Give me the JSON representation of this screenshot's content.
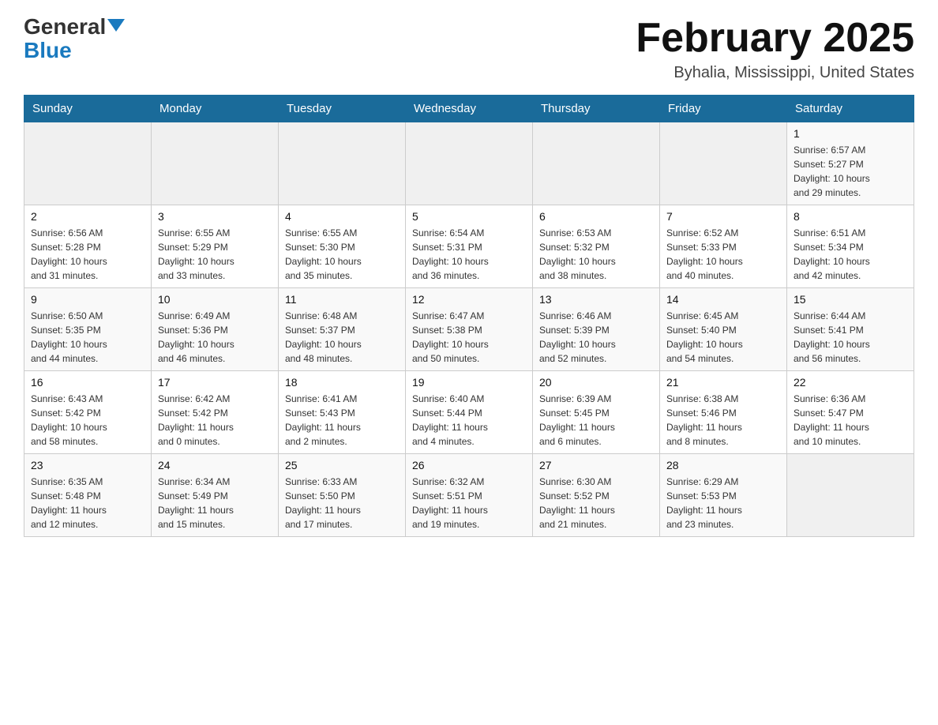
{
  "header": {
    "logo_general": "General",
    "logo_blue": "Blue",
    "month_title": "February 2025",
    "location": "Byhalia, Mississippi, United States"
  },
  "days_of_week": [
    "Sunday",
    "Monday",
    "Tuesday",
    "Wednesday",
    "Thursday",
    "Friday",
    "Saturday"
  ],
  "weeks": [
    {
      "days": [
        {
          "number": "",
          "info": "",
          "empty": true
        },
        {
          "number": "",
          "info": "",
          "empty": true
        },
        {
          "number": "",
          "info": "",
          "empty": true
        },
        {
          "number": "",
          "info": "",
          "empty": true
        },
        {
          "number": "",
          "info": "",
          "empty": true
        },
        {
          "number": "",
          "info": "",
          "empty": true
        },
        {
          "number": "1",
          "info": "Sunrise: 6:57 AM\nSunset: 5:27 PM\nDaylight: 10 hours\nand 29 minutes.",
          "empty": false
        }
      ]
    },
    {
      "days": [
        {
          "number": "2",
          "info": "Sunrise: 6:56 AM\nSunset: 5:28 PM\nDaylight: 10 hours\nand 31 minutes.",
          "empty": false
        },
        {
          "number": "3",
          "info": "Sunrise: 6:55 AM\nSunset: 5:29 PM\nDaylight: 10 hours\nand 33 minutes.",
          "empty": false
        },
        {
          "number": "4",
          "info": "Sunrise: 6:55 AM\nSunset: 5:30 PM\nDaylight: 10 hours\nand 35 minutes.",
          "empty": false
        },
        {
          "number": "5",
          "info": "Sunrise: 6:54 AM\nSunset: 5:31 PM\nDaylight: 10 hours\nand 36 minutes.",
          "empty": false
        },
        {
          "number": "6",
          "info": "Sunrise: 6:53 AM\nSunset: 5:32 PM\nDaylight: 10 hours\nand 38 minutes.",
          "empty": false
        },
        {
          "number": "7",
          "info": "Sunrise: 6:52 AM\nSunset: 5:33 PM\nDaylight: 10 hours\nand 40 minutes.",
          "empty": false
        },
        {
          "number": "8",
          "info": "Sunrise: 6:51 AM\nSunset: 5:34 PM\nDaylight: 10 hours\nand 42 minutes.",
          "empty": false
        }
      ]
    },
    {
      "days": [
        {
          "number": "9",
          "info": "Sunrise: 6:50 AM\nSunset: 5:35 PM\nDaylight: 10 hours\nand 44 minutes.",
          "empty": false
        },
        {
          "number": "10",
          "info": "Sunrise: 6:49 AM\nSunset: 5:36 PM\nDaylight: 10 hours\nand 46 minutes.",
          "empty": false
        },
        {
          "number": "11",
          "info": "Sunrise: 6:48 AM\nSunset: 5:37 PM\nDaylight: 10 hours\nand 48 minutes.",
          "empty": false
        },
        {
          "number": "12",
          "info": "Sunrise: 6:47 AM\nSunset: 5:38 PM\nDaylight: 10 hours\nand 50 minutes.",
          "empty": false
        },
        {
          "number": "13",
          "info": "Sunrise: 6:46 AM\nSunset: 5:39 PM\nDaylight: 10 hours\nand 52 minutes.",
          "empty": false
        },
        {
          "number": "14",
          "info": "Sunrise: 6:45 AM\nSunset: 5:40 PM\nDaylight: 10 hours\nand 54 minutes.",
          "empty": false
        },
        {
          "number": "15",
          "info": "Sunrise: 6:44 AM\nSunset: 5:41 PM\nDaylight: 10 hours\nand 56 minutes.",
          "empty": false
        }
      ]
    },
    {
      "days": [
        {
          "number": "16",
          "info": "Sunrise: 6:43 AM\nSunset: 5:42 PM\nDaylight: 10 hours\nand 58 minutes.",
          "empty": false
        },
        {
          "number": "17",
          "info": "Sunrise: 6:42 AM\nSunset: 5:42 PM\nDaylight: 11 hours\nand 0 minutes.",
          "empty": false
        },
        {
          "number": "18",
          "info": "Sunrise: 6:41 AM\nSunset: 5:43 PM\nDaylight: 11 hours\nand 2 minutes.",
          "empty": false
        },
        {
          "number": "19",
          "info": "Sunrise: 6:40 AM\nSunset: 5:44 PM\nDaylight: 11 hours\nand 4 minutes.",
          "empty": false
        },
        {
          "number": "20",
          "info": "Sunrise: 6:39 AM\nSunset: 5:45 PM\nDaylight: 11 hours\nand 6 minutes.",
          "empty": false
        },
        {
          "number": "21",
          "info": "Sunrise: 6:38 AM\nSunset: 5:46 PM\nDaylight: 11 hours\nand 8 minutes.",
          "empty": false
        },
        {
          "number": "22",
          "info": "Sunrise: 6:36 AM\nSunset: 5:47 PM\nDaylight: 11 hours\nand 10 minutes.",
          "empty": false
        }
      ]
    },
    {
      "days": [
        {
          "number": "23",
          "info": "Sunrise: 6:35 AM\nSunset: 5:48 PM\nDaylight: 11 hours\nand 12 minutes.",
          "empty": false
        },
        {
          "number": "24",
          "info": "Sunrise: 6:34 AM\nSunset: 5:49 PM\nDaylight: 11 hours\nand 15 minutes.",
          "empty": false
        },
        {
          "number": "25",
          "info": "Sunrise: 6:33 AM\nSunset: 5:50 PM\nDaylight: 11 hours\nand 17 minutes.",
          "empty": false
        },
        {
          "number": "26",
          "info": "Sunrise: 6:32 AM\nSunset: 5:51 PM\nDaylight: 11 hours\nand 19 minutes.",
          "empty": false
        },
        {
          "number": "27",
          "info": "Sunrise: 6:30 AM\nSunset: 5:52 PM\nDaylight: 11 hours\nand 21 minutes.",
          "empty": false
        },
        {
          "number": "28",
          "info": "Sunrise: 6:29 AM\nSunset: 5:53 PM\nDaylight: 11 hours\nand 23 minutes.",
          "empty": false
        },
        {
          "number": "",
          "info": "",
          "empty": true
        }
      ]
    }
  ]
}
